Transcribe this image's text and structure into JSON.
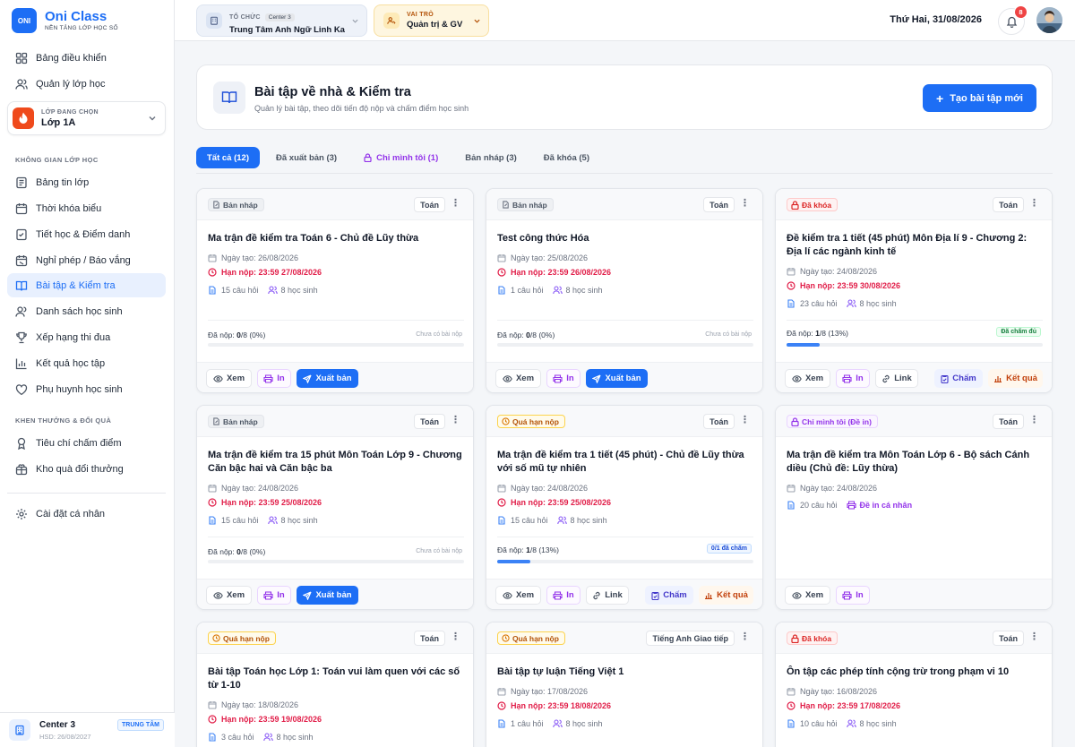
{
  "app": {
    "name": "Oni Class",
    "tagline": "NỀN TẢNG LỚP HỌC SỐ",
    "logo_text": "ONI"
  },
  "sidebar": {
    "top_items": [
      {
        "label": "Bảng điều khiển",
        "icon": "grid-icon"
      },
      {
        "label": "Quản lý lớp học",
        "icon": "users-icon"
      }
    ],
    "class_selector": {
      "label": "LỚP ĐANG CHỌN",
      "value": "Lớp 1A"
    },
    "section1_title": "KHÔNG GIAN LỚP HỌC",
    "section1_items": [
      {
        "label": "Bảng tin lớp",
        "icon": "news-icon"
      },
      {
        "label": "Thời khóa biểu",
        "icon": "calendar-icon"
      },
      {
        "label": "Tiết học & Điểm danh",
        "icon": "checklist-icon"
      },
      {
        "label": "Nghỉ phép / Báo vắng",
        "icon": "leave-icon"
      },
      {
        "label": "Bài tập & Kiểm tra",
        "icon": "book-icon",
        "active": true
      },
      {
        "label": "Danh sách học sinh",
        "icon": "student-icon"
      },
      {
        "label": "Xếp hạng thi đua",
        "icon": "trophy-icon"
      },
      {
        "label": "Kết quả học tập",
        "icon": "chart-icon"
      },
      {
        "label": "Phụ huynh học sinh",
        "icon": "heart-icon"
      }
    ],
    "section2_title": "KHEN THƯỞNG & ĐỔI QUÀ",
    "section2_items": [
      {
        "label": "Tiêu chí chấm điểm",
        "icon": "medal-icon"
      },
      {
        "label": "Kho quà đổi thưởng",
        "icon": "gift-icon"
      }
    ],
    "settings": {
      "label": "Cài đặt cá nhân",
      "icon": "gear-icon"
    },
    "center": {
      "name": "Center 3",
      "expiry": "HSD: 26/08/2027",
      "badge": "TRUNG TÂM"
    }
  },
  "header": {
    "org": {
      "label": "TỔ CHỨC",
      "badge": "Center 3",
      "value": "Trung Tâm Anh Ngữ Linh Ka"
    },
    "role": {
      "label": "VAI TRÒ",
      "value": "Quản trị & GV"
    },
    "date": "Thứ Hai, 31/08/2026",
    "notifications": "8"
  },
  "page": {
    "title": "Bài tập về nhà & Kiểm tra",
    "subtitle": "Quản lý bài tập, theo dõi tiến độ nộp và chấm điểm học sinh",
    "create_button": "Tạo bài tập mới"
  },
  "tabs": [
    "Tất cả (12)",
    "Đã xuất bản (3)",
    "Chỉ mình tôi (1)",
    "Bản nháp (3)",
    "Đã khóa (5)"
  ],
  "labels": {
    "view": "Xem",
    "print": "In",
    "publish": "Xuất bản",
    "link": "Link",
    "grade": "Chấm",
    "result": "Kết quả",
    "submitted": "Đã nộp:",
    "no_submission": "Chưa có bài nộp"
  },
  "cards": [
    {
      "status": "Bản nháp",
      "subject": "Toán",
      "title": "Ma trận đề kiểm tra Toán 6 - Chủ đề Lũy thừa",
      "created": "Ngày tạo: 26/08/2026",
      "deadline": "Hạn nộp: 23:59 27/08/2026",
      "questions": "15 câu hỏi",
      "students": "8 học sinh",
      "submitted_count": "0",
      "submitted_rest": "/8 (0%)",
      "progress": 0,
      "right": "Chưa có bài nộp"
    },
    {
      "status": "Bản nháp",
      "subject": "Toán",
      "title": "Test công thức Hóa",
      "created": "Ngày tạo: 25/08/2026",
      "deadline": "Hạn nộp: 23:59 26/08/2026",
      "questions": "1 câu hỏi",
      "students": "8 học sinh",
      "submitted_count": "0",
      "submitted_rest": "/8 (0%)",
      "progress": 0,
      "right": "Chưa có bài nộp"
    },
    {
      "status": "Đã khóa",
      "subject": "Toán",
      "title": "Đề kiểm tra 1 tiết (45 phút) Môn Địa lí 9 - Chương 2: Địa lí các ngành kinh tế",
      "created": "Ngày tạo: 24/08/2026",
      "deadline": "Hạn nộp: 23:59 30/08/2026",
      "questions": "23 câu hỏi",
      "students": "8 học sinh",
      "submitted_count": "1",
      "submitted_rest": "/8 (13%)",
      "progress": 0.13,
      "right": "Đã chấm đủ"
    },
    {
      "status": "Bản nháp",
      "subject": "Toán",
      "title": "Ma trận đề kiểm tra 15 phút Môn Toán Lớp 9 - Chương Căn bậc hai và Căn bậc ba",
      "created": "Ngày tạo: 24/08/2026",
      "deadline": "Hạn nộp: 23:59 25/08/2026",
      "questions": "15 câu hỏi",
      "students": "8 học sinh",
      "submitted_count": "0",
      "submitted_rest": "/8 (0%)",
      "progress": 0,
      "right": "Chưa có bài nộp"
    },
    {
      "status": "Quá hạn nộp",
      "subject": "Toán",
      "title": "Ma trận đề kiểm tra 1 tiết (45 phút) - Chủ đề Lũy thừa với số mũ tự nhiên",
      "created": "Ngày tạo: 24/08/2026",
      "deadline": "Hạn nộp: 23:59 25/08/2026",
      "questions": "15 câu hỏi",
      "students": "8 học sinh",
      "submitted_count": "1",
      "submitted_rest": "/8 (13%)",
      "progress": 0.13,
      "right": "0/1 đã chấm"
    },
    {
      "status": "Chỉ mình tôi (Đề in)",
      "subject": "Toán",
      "title": "Ma trận đề kiểm tra Môn Toán Lớp 6 - Bộ sách Cánh diều (Chủ đề: Lũy thừa)",
      "created": "Ngày tạo: 24/08/2026",
      "questions": "20 câu hỏi",
      "print_tag": "Đề in cá nhân"
    },
    {
      "status": "Quá hạn nộp",
      "subject": "Toán",
      "title": "Bài tập Toán học Lớp 1: Toán vui làm quen với các số từ 1-10",
      "created": "Ngày tạo: 18/08/2026",
      "deadline": "Hạn nộp: 23:59 19/08/2026",
      "questions": "3 câu hỏi",
      "students": "8 học sinh"
    },
    {
      "status": "Quá hạn nộp",
      "subject": "Tiếng Anh Giao tiếp",
      "title": "Bài tập tự luận Tiếng Việt 1",
      "created": "Ngày tạo: 17/08/2026",
      "deadline": "Hạn nộp: 23:59 18/08/2026",
      "questions": "1 câu hỏi",
      "students": "8 học sinh"
    },
    {
      "status": "Đã khóa",
      "subject": "Toán",
      "title": "Ôn tập các phép tính cộng trừ trong phạm vi 10",
      "created": "Ngày tạo: 16/08/2026",
      "deadline": "Hạn nộp: 23:59 17/08/2026",
      "questions": "10 câu hỏi",
      "students": "8 học sinh"
    }
  ]
}
